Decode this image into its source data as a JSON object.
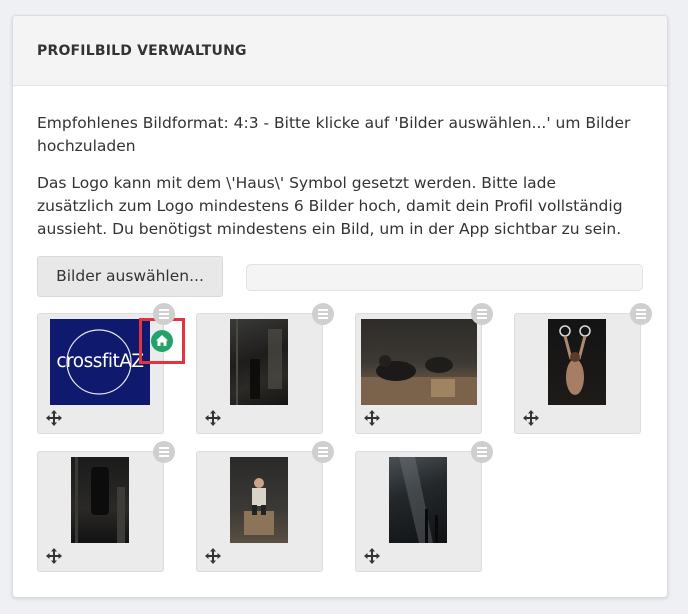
{
  "panel": {
    "title": "PROFILBILD VERWALTUNG",
    "description_1": "Empfohlenes Bildformat: 4:3 - Bitte klicke auf 'Bilder auswählen...' um Bilder hochzuladen",
    "description_2": "Das Logo kann mit dem \\'Haus\\' Symbol gesetzt werden. Bitte lade zusätzlich zum Logo mindestens 6 Bilder hoch, damit dein Profil vollständig aussieht. Du benötigst mindestens ein Bild, um in der App sichtbar zu sein.",
    "select_button": "Bilder auswählen...",
    "upload_progress": 0
  },
  "images": [
    {
      "kind": "logo",
      "logo_text": "crossfitAZ",
      "is_logo": true,
      "icons": [
        "menu-icon",
        "home-icon",
        "move-icon"
      ]
    },
    {
      "kind": "photo",
      "scene": "dark gym interior",
      "icons": [
        "menu-icon",
        "move-icon"
      ]
    },
    {
      "kind": "photo",
      "scene": "athletes doing box jumps",
      "icons": [
        "menu-icon",
        "move-icon"
      ]
    },
    {
      "kind": "photo",
      "scene": "athlete on gymnastic rings",
      "icons": [
        "menu-icon",
        "move-icon"
      ]
    },
    {
      "kind": "photo",
      "scene": "punching bag in dark gym",
      "icons": [
        "menu-icon",
        "move-icon"
      ]
    },
    {
      "kind": "photo",
      "scene": "athlete on plyo box",
      "icons": [
        "menu-icon",
        "move-icon"
      ]
    },
    {
      "kind": "photo",
      "scene": "dark gym with light beam",
      "icons": [
        "menu-icon",
        "move-icon"
      ]
    }
  ],
  "colors": {
    "accent_green": "#21a36a",
    "highlight_red": "#e2343f",
    "logo_navy": "#0f1a6e"
  }
}
